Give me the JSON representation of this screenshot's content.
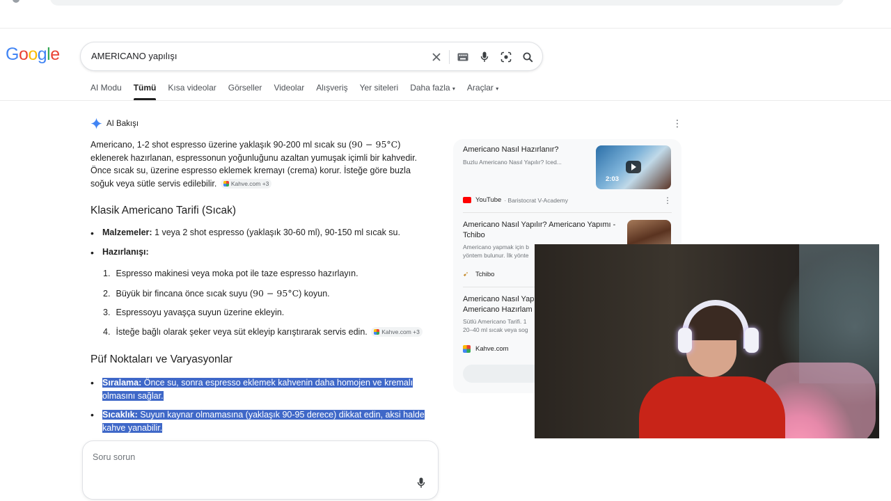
{
  "search": {
    "query": "AMERICANO yapılışı"
  },
  "logo": {
    "letters": [
      "G",
      "o",
      "o",
      "g",
      "l",
      "e"
    ],
    "colors": [
      "#4285f4",
      "#ea4335",
      "#fbbc05",
      "#4285f4",
      "#34a853",
      "#ea4335"
    ]
  },
  "tabs": [
    "AI Modu",
    "Tümü",
    "Kısa videolar",
    "Görseller",
    "Videolar",
    "Alışveriş",
    "Yer siteleri",
    "Daha fazla",
    "Araçlar"
  ],
  "tabs_active": "Tümü",
  "ai_overview": {
    "label": "AI Bakışı",
    "intro": {
      "part1": "Americano, 1-2 shot espresso üzerine yaklaşık 90-200 ml sıcak su (",
      "math": "90 − 95°C",
      "part2": ") eklenerek hazırlanan, espressonun yoğunluğunu azaltan yumuşak içimli bir kahvedir. Önce sıcak su, üzerine espresso eklemek kremayı (crema) korur. İsteğe göre buzla soğuk veya sütle servis edilebilir.",
      "citation": "Kahve.com +3"
    },
    "section1_title": "Klasik Americano Tarifi (Sıcak)",
    "materials_label": "Malzemeler:",
    "materials_text": " 1 veya 2 shot espresso (yaklaşık 30-60 ml), 90-150 ml sıcak su.",
    "preparation_label": "Hazırlanışı:",
    "steps": [
      {
        "n": "1.",
        "text": "Espresso makinesi veya moka pot ile taze espresso hazırlayın."
      },
      {
        "n": "2.",
        "pre": "Büyük bir fincana önce sıcak suyu (",
        "math": "90 − 95°C",
        "post": ") koyun."
      },
      {
        "n": "3.",
        "text": "Espressoyu yavaşça suyun üzerine ekleyin."
      },
      {
        "n": "4.",
        "text": "İsteğe bağlı olarak şeker veya süt ekleyip karıştırarak servis edin.",
        "citation": "Kahve.com +3"
      }
    ],
    "section2_title": "Püf Noktaları ve Varyasyonlar",
    "tips": [
      {
        "label": "Sıralama:",
        "line1": " Önce su, sonra espresso eklemek kahvenin daha homojen ve kremalı",
        "line2": "olmasını sağlar."
      },
      {
        "label": "Sıcaklık:",
        "line1": " Suyun kaynar olmamasına (yaklaşık 90-95 derece) dikkat edin, aksi halde",
        "line2": "kahve yanabilir."
      }
    ]
  },
  "ask": {
    "placeholder": "Soru sorun"
  },
  "sources": [
    {
      "title": "Americano Nasıl Hazırlanır?",
      "snippet": "Buzlu Americano Nasıl Yapılır? Iced...",
      "site": "YouTube",
      "site_tail": "· Baristocrat V-Academy",
      "duration": "2:03"
    },
    {
      "title_line1": "Americano Nasıl Yapılır? Americano Yapımı -",
      "title_line2": "Tchibo",
      "snippet_line1": "Americano yapmak için b",
      "snippet_line2": "yöntem bulunur. İlk yönte",
      "site": "Tchibo"
    },
    {
      "title_line1": "Americano Nasıl Yap",
      "title_line2": "Americano Hazırlam",
      "snippet_line1": "Sütlü Americano Tarifi. 1",
      "snippet_line2": "20–40 ml sıcak veya sog",
      "site": "Kahve.com"
    }
  ],
  "colors": {
    "highlight": "#3f68c8",
    "ai_spark": "#4285f4"
  }
}
